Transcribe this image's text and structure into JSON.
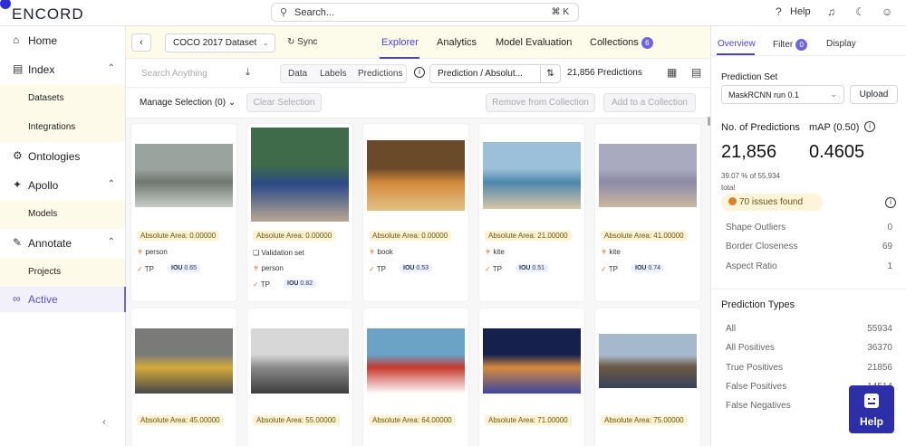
{
  "app": {
    "logo": "ENCORD"
  },
  "topbar": {
    "search_placeholder": "Search...",
    "shortcut": "⌘ K",
    "help_label": "Help"
  },
  "sidebar": {
    "home": "Home",
    "index": "Index",
    "datasets": "Datasets",
    "integrations": "Integrations",
    "ontologies": "Ontologies",
    "apollo": "Apollo",
    "models": "Models",
    "annotate": "Annotate",
    "projects": "Projects",
    "active": "Active"
  },
  "header": {
    "dataset": "COCO 2017 Dataset",
    "sync": "Sync",
    "tabs": [
      "Explorer",
      "Analytics",
      "Model Evaluation",
      "Collections"
    ],
    "collections_count": "6"
  },
  "filters": {
    "search_placeholder": "Search Anything",
    "segments": [
      "Data",
      "Labels",
      "Predictions"
    ],
    "prediction_metric": "Prediction / Absolut...",
    "prediction_count": "21,856 Predictions"
  },
  "selection": {
    "manage": "Manage Selection (0)",
    "clear": "Clear Selection",
    "remove": "Remove from Collection",
    "add": "Add to a Collection"
  },
  "cards": [
    {
      "area": "Absolute Area: 0.00000",
      "label": "person",
      "iou": "0.65",
      "colors": [
        "#9aa39e",
        "#6f7770",
        "#c9cdc8"
      ]
    },
    {
      "area": "Absolute Area: 0.00000",
      "validation": "Validation set",
      "label": "person",
      "iou": "0.82",
      "colors": [
        "#3f6b4a",
        "#2b4a86",
        "#b9a993"
      ]
    },
    {
      "area": "Absolute Area: 0.00000",
      "label": "book",
      "iou": "0.53",
      "colors": [
        "#6b4a2a",
        "#d48a3b",
        "#e1c288"
      ]
    },
    {
      "area": "Absolute Area: 21.00000",
      "label": "kite",
      "iou": "0.51",
      "colors": [
        "#9cc0d9",
        "#4d86ad",
        "#d8c7a7"
      ]
    },
    {
      "area": "Absolute Area: 41.00000",
      "label": "kite",
      "iou": "0.74",
      "colors": [
        "#a9a9c0",
        "#8c8aa8",
        "#c9b7a0"
      ]
    },
    {
      "area": "Absolute Area: 45.00000",
      "colors": [
        "#7a7b78",
        "#d4aa3a",
        "#46474a"
      ]
    },
    {
      "area": "Absolute Area: 55.00000",
      "colors": [
        "#d7d7d7",
        "#8a8a8a",
        "#3d3d3d"
      ]
    },
    {
      "area": "Absolute Area: 64.00000",
      "colors": [
        "#6aa3c6",
        "#c7392e",
        "#ffffff"
      ]
    },
    {
      "area": "Absolute Area: 71.00000",
      "colors": [
        "#15204d",
        "#d58a3c",
        "#3a46a0"
      ]
    },
    {
      "area": "Absolute Area: 75.00000",
      "colors": [
        "#a6b8cc",
        "#6b5b44",
        "#39415a"
      ]
    }
  ],
  "tp_label": "TP",
  "iou_label": "IOU",
  "panel": {
    "tabs": [
      "Overview",
      "Filter",
      "Display"
    ],
    "filter_count": "0",
    "prediction_set_title": "Prediction Set",
    "model": "MaskRCNN run 0.1",
    "upload": "Upload",
    "num_predictions_label": "No. of Predictions",
    "map_label": "mAP (0.50)",
    "num_predictions": "21,856",
    "map": "0.4605",
    "pct_line": "39.07 % of 55,934",
    "total": "total",
    "issues": "70 issues found",
    "issue_rows": [
      {
        "name": "Shape Outliers",
        "value": "0"
      },
      {
        "name": "Border Closeness",
        "value": "69"
      },
      {
        "name": "Aspect Ratio",
        "value": "1"
      }
    ],
    "types_title": "Prediction Types",
    "type_rows": [
      {
        "name": "All",
        "value": "55934"
      },
      {
        "name": "All Positives",
        "value": "36370"
      },
      {
        "name": "True Positives",
        "value": "21856"
      },
      {
        "name": "False Positives",
        "value": "14514"
      },
      {
        "name": "False Negatives",
        "value": ""
      }
    ]
  },
  "help_button": "Help"
}
